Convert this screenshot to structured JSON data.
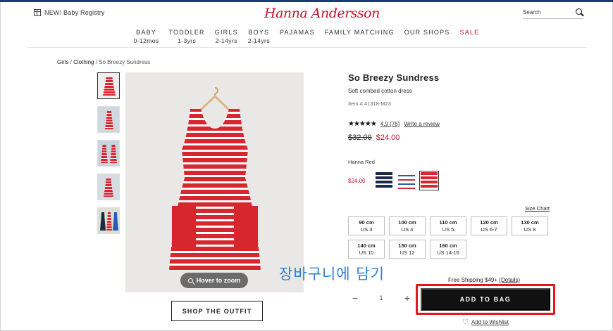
{
  "header": {
    "registry_label": "NEW! Baby Registry",
    "logo_text": "Hanna Andersson",
    "search_placeholder": "Search"
  },
  "nav": [
    {
      "label": "BABY",
      "sub": "0-12mos"
    },
    {
      "label": "TODDLER",
      "sub": "1-3yrs"
    },
    {
      "label": "GIRLS",
      "sub": "2-14yrs"
    },
    {
      "label": "BOYS",
      "sub": "2-14yrs"
    },
    {
      "label": "PAJAMAS",
      "sub": ""
    },
    {
      "label": "FAMILY MATCHING",
      "sub": ""
    },
    {
      "label": "OUR SHOPS",
      "sub": ""
    },
    {
      "label": "SALE",
      "sub": ""
    }
  ],
  "breadcrumb": {
    "items": [
      "Girls",
      "Clothing",
      "So Breezy Sundress"
    ],
    "separator": " / "
  },
  "gallery": {
    "zoom_label": "Hover to zoom",
    "shop_outfit_label": "SHOP THE OUTFIT"
  },
  "product": {
    "title": "So Breezy Sundress",
    "subtitle": "Soft combed cotton dress",
    "item_number": "Item # 41318-M23",
    "stars": "★★★★★",
    "rating": "4.9",
    "review_count": "(76)",
    "write_review": "Write a review",
    "old_price": "$32.00",
    "new_price": "$24.00",
    "color_name": "Hanna Red",
    "swatch_price": "$24.00",
    "swatches": [
      {
        "name": "navy-stripe",
        "colors": [
          "#1c2a48",
          "#ffffff"
        ]
      },
      {
        "name": "multi-stripe",
        "colors": [
          "#ffffff",
          "#2a5bb8",
          "#d8262e"
        ]
      },
      {
        "name": "red-stripe",
        "colors": [
          "#d8262e",
          "#ffffff"
        ]
      }
    ],
    "size_chart_label": "Size Chart",
    "sizes": [
      {
        "cm": "90 cm",
        "us": "US 3"
      },
      {
        "cm": "100 cm",
        "us": "US 4"
      },
      {
        "cm": "110 cm",
        "us": "US 5"
      },
      {
        "cm": "120 cm",
        "us": "US 6-7"
      },
      {
        "cm": "130 cm",
        "us": "US 8"
      },
      {
        "cm": "140 cm",
        "us": "US 10"
      },
      {
        "cm": "150 cm",
        "us": "US 12"
      },
      {
        "cm": "160 cm",
        "us": "US 14-16"
      }
    ],
    "shipping_label": "Free Shipping $49+",
    "shipping_details": "(Details)",
    "quantity": "1",
    "qty_minus": "−",
    "qty_plus": "+",
    "add_to_bag_label": "ADD TO BAG",
    "wishlist_label": "Add to Wishlist"
  },
  "annotation": {
    "text": "장바구니에 담기",
    "color": "#2b7fd6",
    "highlight_color": "#e01818"
  }
}
